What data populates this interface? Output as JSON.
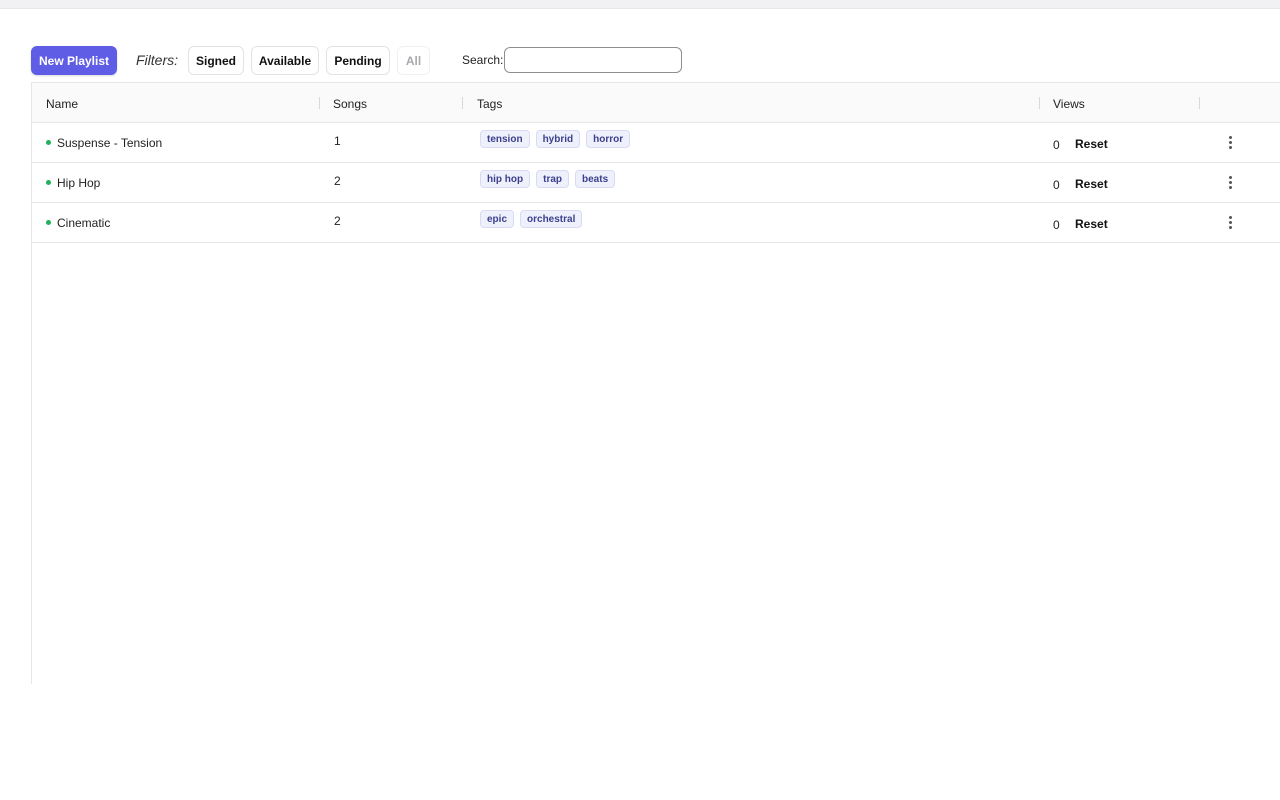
{
  "toolbar": {
    "new_playlist_label": "New Playlist",
    "filters_label": "Filters:",
    "filters": [
      {
        "label": "Signed",
        "enabled": true
      },
      {
        "label": "Available",
        "enabled": true
      },
      {
        "label": "Pending",
        "enabled": true
      },
      {
        "label": "All",
        "enabled": false
      }
    ],
    "search_label": "Search:",
    "search_value": "",
    "search_placeholder": ""
  },
  "table": {
    "columns": [
      "Name",
      "Songs",
      "Tags",
      "Views"
    ],
    "rows": [
      {
        "name": "Suspense - Tension",
        "status": "active",
        "songs": "1",
        "tags": [
          "tension",
          "hybrid",
          "horror"
        ],
        "views": "0",
        "reset_label": "Reset",
        "menu_icon": "more-vertical-icon"
      },
      {
        "name": "Hip Hop",
        "status": "active",
        "songs": "2",
        "tags": [
          "hip hop",
          "trap",
          "beats"
        ],
        "views": "0",
        "reset_label": "Reset",
        "menu_icon": "more-vertical-icon"
      },
      {
        "name": "Cinematic",
        "status": "active",
        "songs": "2",
        "tags": [
          "epic",
          "orchestral"
        ],
        "views": "0",
        "reset_label": "Reset",
        "menu_icon": "more-vertical-icon"
      }
    ]
  },
  "colors": {
    "primary": "#5f5ce6",
    "status_active": "#22b35a",
    "tag_bg": "#eef0fb",
    "tag_text": "#3c3f8c"
  }
}
